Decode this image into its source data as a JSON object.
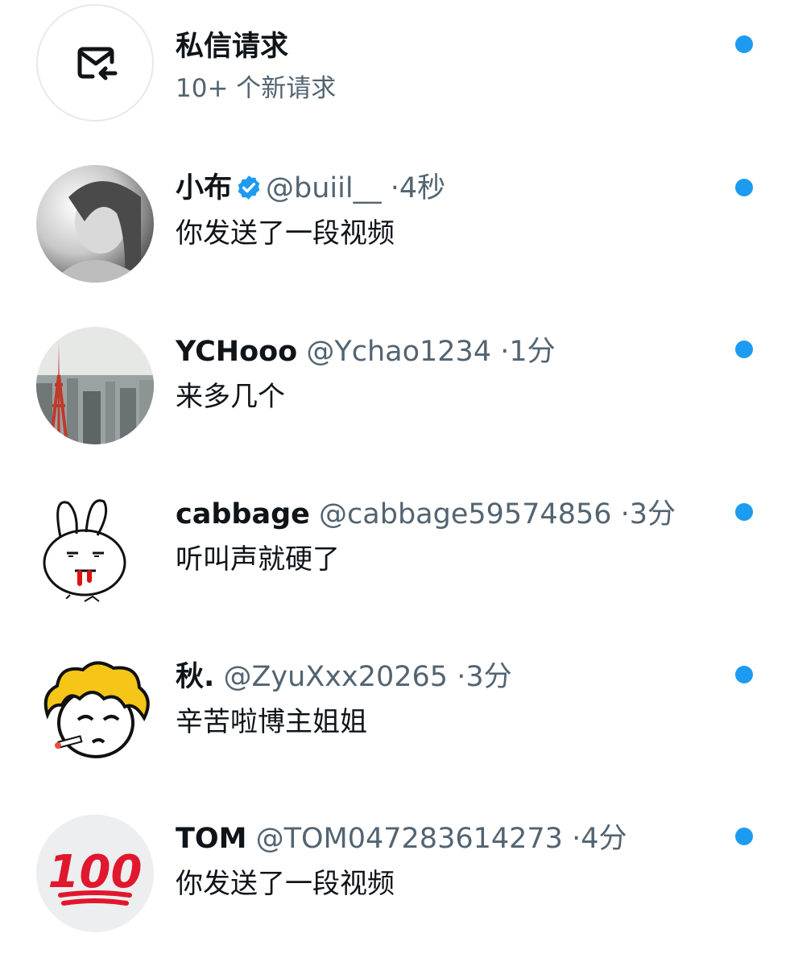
{
  "requests": {
    "title": "私信请求",
    "subtitle": "10+ 个新请求"
  },
  "conversations": [
    {
      "name": "小布",
      "verified": true,
      "handle": "@buiil__",
      "separator": "·",
      "time": "4秒",
      "preview": "你发送了一段视频"
    },
    {
      "name": "YCHooo",
      "verified": false,
      "handle": "@Ychao1234",
      "separator": "·",
      "time": "1分",
      "preview": "来多几个"
    },
    {
      "name": "cabbage",
      "verified": false,
      "handle": "@cabbage59574856",
      "separator": "·",
      "time": "3分",
      "preview": "听叫声就硬了"
    },
    {
      "name": "秋.",
      "verified": false,
      "handle": "@ZyuXxx20265",
      "separator": "·",
      "time": "3分",
      "preview": "辛苦啦博主姐姐"
    },
    {
      "name": "TOM",
      "verified": false,
      "handle": "@TOM047283614273",
      "separator": "·",
      "time": "4分",
      "preview": "你发送了一段视频"
    }
  ],
  "colors": {
    "unread_dot": "#1d9bf0",
    "secondary_text": "#536471",
    "primary_text": "#0f1419",
    "verified_badge": "#1d9bf0"
  },
  "icons": {
    "requests": "mail-arrow-icon",
    "verified": "verified-badge-icon",
    "unread": "unread-dot-icon"
  }
}
